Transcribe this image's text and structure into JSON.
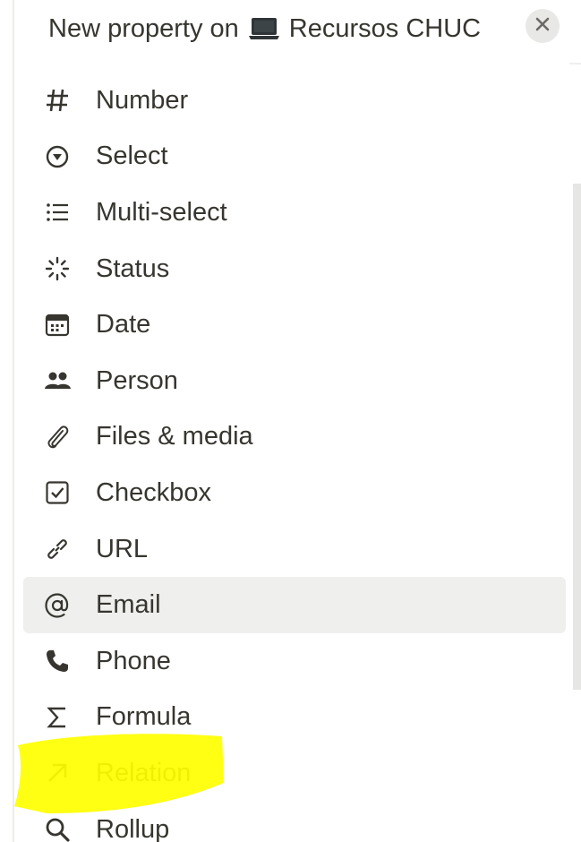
{
  "header": {
    "title_prefix": "New property on",
    "database_name": "Recursos CHUC",
    "close_symbol": "✕"
  },
  "menu": {
    "items": [
      {
        "label": "Number",
        "icon": "hash-icon"
      },
      {
        "label": "Select",
        "icon": "select-circle-icon"
      },
      {
        "label": "Multi-select",
        "icon": "list-icon"
      },
      {
        "label": "Status",
        "icon": "status-spinner-icon"
      },
      {
        "label": "Date",
        "icon": "calendar-icon"
      },
      {
        "label": "Person",
        "icon": "people-icon"
      },
      {
        "label": "Files & media",
        "icon": "paperclip-icon"
      },
      {
        "label": "Checkbox",
        "icon": "checkbox-icon"
      },
      {
        "label": "URL",
        "icon": "link-icon"
      },
      {
        "label": "Email",
        "icon": "at-icon"
      },
      {
        "label": "Phone",
        "icon": "phone-icon"
      },
      {
        "label": "Formula",
        "icon": "sigma-icon"
      },
      {
        "label": "Relation",
        "icon": "arrow-up-right-icon"
      },
      {
        "label": "Rollup",
        "icon": "search-icon"
      }
    ],
    "hovered_item": "Email"
  },
  "colors": {
    "text": "#37352f",
    "hover_bg": "#efefee",
    "highlight": "#ffff00"
  }
}
